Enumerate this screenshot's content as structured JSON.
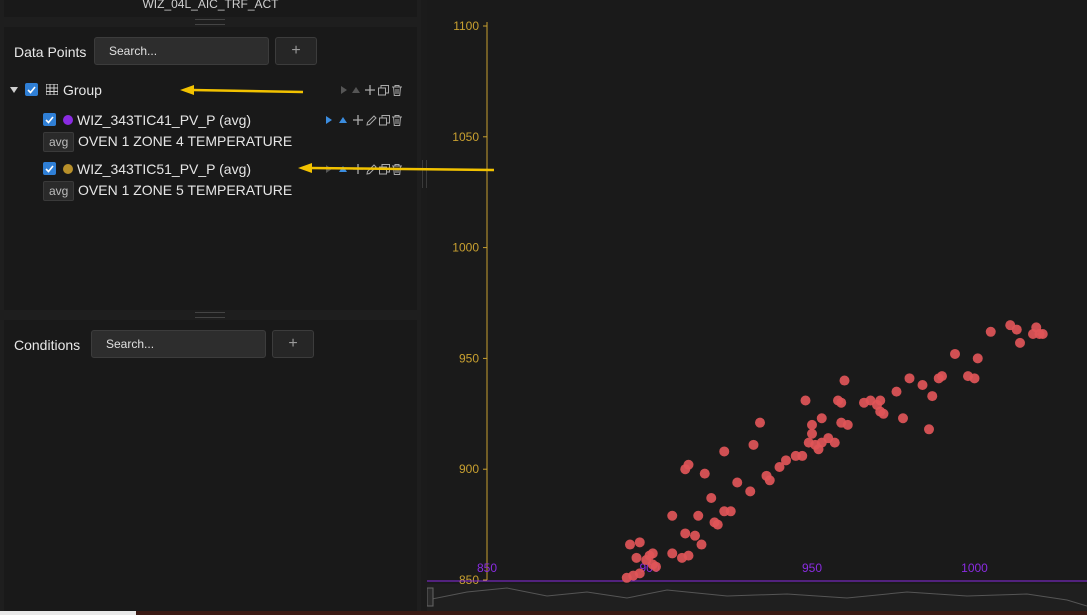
{
  "top_strip": {
    "title": "WIZ_04L_AIC_TRF_ACT"
  },
  "data_points": {
    "label": "Data Points",
    "search_placeholder": "Search...",
    "add_label": "+",
    "group": {
      "name": "Group"
    },
    "items": [
      {
        "name": "WIZ_343TIC41_PV_P (avg)",
        "badge": "avg",
        "description": "OVEN 1 ZONE 4 TEMPERATURE",
        "color": "#8a2be2"
      },
      {
        "name": "WIZ_343TIC51_PV_P (avg)",
        "badge": "avg",
        "description": "OVEN 1 ZONE 5 TEMPERATURE",
        "color": "#b8902a"
      }
    ]
  },
  "conditions": {
    "label": "Conditions",
    "search_placeholder": "Search...",
    "add_label": "+"
  },
  "colors": {
    "y_axis": "#c8a030",
    "x_axis": "#8a2be2",
    "points": "#e05558",
    "annotation_arrow": "#f2c200"
  },
  "chart_data": {
    "type": "scatter",
    "title": "",
    "xlabel": "",
    "ylabel": "",
    "xlim": [
      850,
      1020
    ],
    "ylim": [
      850,
      1100
    ],
    "x_ticks": [
      "850",
      "900",
      "950",
      "1000"
    ],
    "y_ticks": [
      "850",
      "900",
      "950",
      "1000",
      "1050",
      "1100"
    ],
    "grid": false,
    "legend": "none",
    "points": [
      [
        893,
        851
      ],
      [
        895,
        852
      ],
      [
        897,
        853
      ],
      [
        894,
        866
      ],
      [
        897,
        867
      ],
      [
        896,
        860
      ],
      [
        900,
        861
      ],
      [
        901,
        862
      ],
      [
        901,
        857
      ],
      [
        902,
        856
      ],
      [
        899,
        859
      ],
      [
        907,
        862
      ],
      [
        910,
        860
      ],
      [
        912,
        861
      ],
      [
        911,
        871
      ],
      [
        914,
        870
      ],
      [
        916,
        866
      ],
      [
        907,
        879
      ],
      [
        915,
        879
      ],
      [
        911,
        900
      ],
      [
        912,
        902
      ],
      [
        917,
        898
      ],
      [
        919,
        887
      ],
      [
        920,
        876
      ],
      [
        921,
        875
      ],
      [
        923,
        881
      ],
      [
        925,
        881
      ],
      [
        923,
        908
      ],
      [
        927,
        894
      ],
      [
        931,
        890
      ],
      [
        932,
        911
      ],
      [
        934,
        921
      ],
      [
        936,
        897
      ],
      [
        937,
        895
      ],
      [
        940,
        901
      ],
      [
        942,
        904
      ],
      [
        945,
        906
      ],
      [
        947,
        906
      ],
      [
        948,
        931
      ],
      [
        949,
        912
      ],
      [
        950,
        920
      ],
      [
        950,
        916
      ],
      [
        951,
        911
      ],
      [
        952,
        909
      ],
      [
        953,
        923
      ],
      [
        953,
        912
      ],
      [
        955,
        914
      ],
      [
        957,
        912
      ],
      [
        958,
        931
      ],
      [
        959,
        930
      ],
      [
        959,
        921
      ],
      [
        960,
        940
      ],
      [
        961,
        920
      ],
      [
        966,
        930
      ],
      [
        968,
        931
      ],
      [
        970,
        929
      ],
      [
        971,
        931
      ],
      [
        971,
        926
      ],
      [
        972,
        925
      ],
      [
        976,
        935
      ],
      [
        978,
        923
      ],
      [
        980,
        941
      ],
      [
        984,
        938
      ],
      [
        986,
        918
      ],
      [
        987,
        933
      ],
      [
        989,
        941
      ],
      [
        990,
        942
      ],
      [
        994,
        952
      ],
      [
        998,
        942
      ],
      [
        1000,
        941
      ],
      [
        1001,
        950
      ],
      [
        1005,
        962
      ],
      [
        1011,
        965
      ],
      [
        1013,
        963
      ],
      [
        1014,
        957
      ],
      [
        1018,
        961
      ],
      [
        1019,
        964
      ],
      [
        1020,
        961
      ],
      [
        1021,
        961
      ]
    ]
  }
}
